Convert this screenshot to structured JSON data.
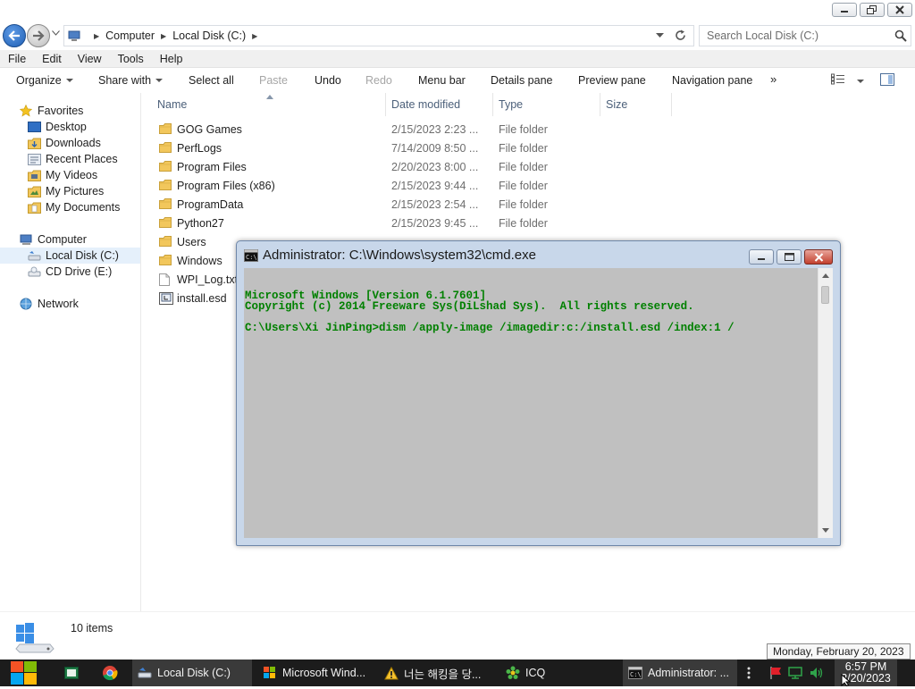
{
  "explorer": {
    "breadcrumb": [
      "Computer",
      "Local Disk (C:)"
    ],
    "search_placeholder": "Search Local Disk (C:)",
    "menu": [
      "File",
      "Edit",
      "View",
      "Tools",
      "Help"
    ],
    "commands": {
      "organize": "Organize",
      "share_with": "Share with",
      "select_all": "Select all",
      "paste": "Paste",
      "undo": "Undo",
      "redo": "Redo",
      "menu_bar": "Menu bar",
      "details_pane": "Details pane",
      "preview_pane": "Preview pane",
      "navigation_pane": "Navigation pane",
      "more": "»"
    },
    "nav": {
      "favorites": "Favorites",
      "favorites_items": [
        "Desktop",
        "Downloads",
        "Recent Places",
        "My Videos",
        "My Pictures",
        "My Documents"
      ],
      "computer": "Computer",
      "computer_items": [
        "Local Disk (C:)",
        "CD Drive (E:)"
      ],
      "network": "Network"
    },
    "columns": [
      "Name",
      "Date modified",
      "Type",
      "Size"
    ],
    "files": [
      {
        "name": "GOG Games",
        "date": "2/15/2023 2:23 ...",
        "type": "File folder",
        "icon": "folder-icon"
      },
      {
        "name": "PerfLogs",
        "date": "7/14/2009 8:50 ...",
        "type": "File folder",
        "icon": "folder-icon"
      },
      {
        "name": "Program Files",
        "date": "2/20/2023 8:00 ...",
        "type": "File folder",
        "icon": "folder-icon"
      },
      {
        "name": "Program Files (x86)",
        "date": "2/15/2023 9:44 ...",
        "type": "File folder",
        "icon": "folder-icon"
      },
      {
        "name": "ProgramData",
        "date": "2/15/2023 2:54 ...",
        "type": "File folder",
        "icon": "folder-icon"
      },
      {
        "name": "Python27",
        "date": "2/15/2023 9:45 ...",
        "type": "File folder",
        "icon": "folder-icon"
      },
      {
        "name": "Users",
        "date": "",
        "type": "",
        "icon": "folder-icon"
      },
      {
        "name": "Windows",
        "date": "",
        "type": "",
        "icon": "folder-icon"
      },
      {
        "name": "WPI_Log.txt",
        "date": "",
        "type": "",
        "icon": "text-file-icon"
      },
      {
        "name": "install.esd",
        "date": "",
        "type": "",
        "icon": "esd-file-icon"
      }
    ],
    "item_count": "10 items"
  },
  "cmd_window": {
    "title": "Administrator: C:\\Windows\\system32\\cmd.exe",
    "lines": [
      "Microsoft Windows [Version 6.1.7601]",
      "Copyright (c) 2014 Freeware Sys(DiLshad Sys).  All rights reserved.",
      "",
      "C:\\Users\\Xi JinPing>dism /apply-image /imagedir:c:/install.esd /index:1 /"
    ],
    "text_color": "#008000",
    "background_color": "#c0c0c0"
  },
  "taskbar": {
    "items": [
      {
        "label": "Local Disk (C:)",
        "icon": "explorer-icon"
      },
      {
        "label": "Microsoft Wind...",
        "icon": "installer-icon"
      },
      {
        "label": "너는 해킹을 당...",
        "icon": "warning-icon"
      },
      {
        "label": "ICQ",
        "icon": "icq-icon"
      },
      {
        "label": "Administrator: ...",
        "icon": "cmd-icon"
      }
    ],
    "clock_time": "6:57 PM",
    "clock_date": "2/20/2023",
    "date_tooltip": "Monday, February 20, 2023"
  }
}
